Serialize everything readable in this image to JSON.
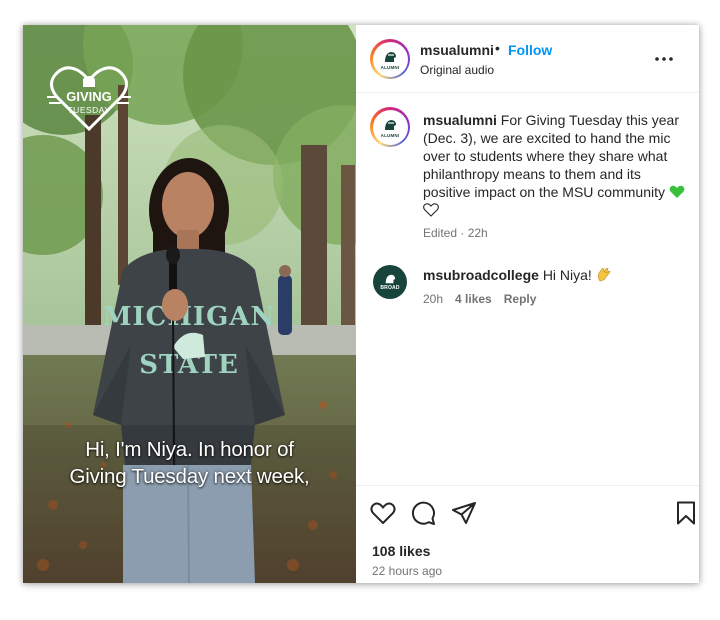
{
  "media": {
    "badge_line1": "GIVING",
    "badge_line2": "TUESDAY",
    "sweatshirt_top": "MICHIGAN",
    "sweatshirt_bottom": "STATE",
    "caption_line1": "Hi, I'm Niya. In honor of",
    "caption_line2": "Giving Tuesday next week,"
  },
  "header": {
    "username": "msualumni",
    "separator": "•",
    "follow_label": "Follow",
    "subtitle": "Original audio",
    "avatar_label": "ALUMNI"
  },
  "caption": {
    "username": "msualumni",
    "text": "For Giving Tuesday this year (Dec. 3), we are excited to hand the mic over to students where they share what philanthropy means to them and its positive impact on the MSU community",
    "emojis": [
      "green-heart",
      "white-heart"
    ],
    "meta": "Edited · 22h",
    "avatar_label": "ALUMNI"
  },
  "comment": {
    "username": "msubroadcollege",
    "text": "Hi Niya!",
    "emoji": "waving-hand",
    "avatar_label": "BROAD",
    "time": "20h",
    "likes": "4 likes",
    "reply_label": "Reply"
  },
  "actions": {
    "icons": [
      "heart-outline",
      "comment-bubble",
      "paper-plane",
      "bookmark"
    ],
    "likes": "108 likes",
    "time_ago": "22 hours ago"
  },
  "colors": {
    "msu_green": "#18453b",
    "follow_blue": "#0095f6",
    "heart_green": "#3ac13a",
    "meta_gray": "#737373"
  }
}
